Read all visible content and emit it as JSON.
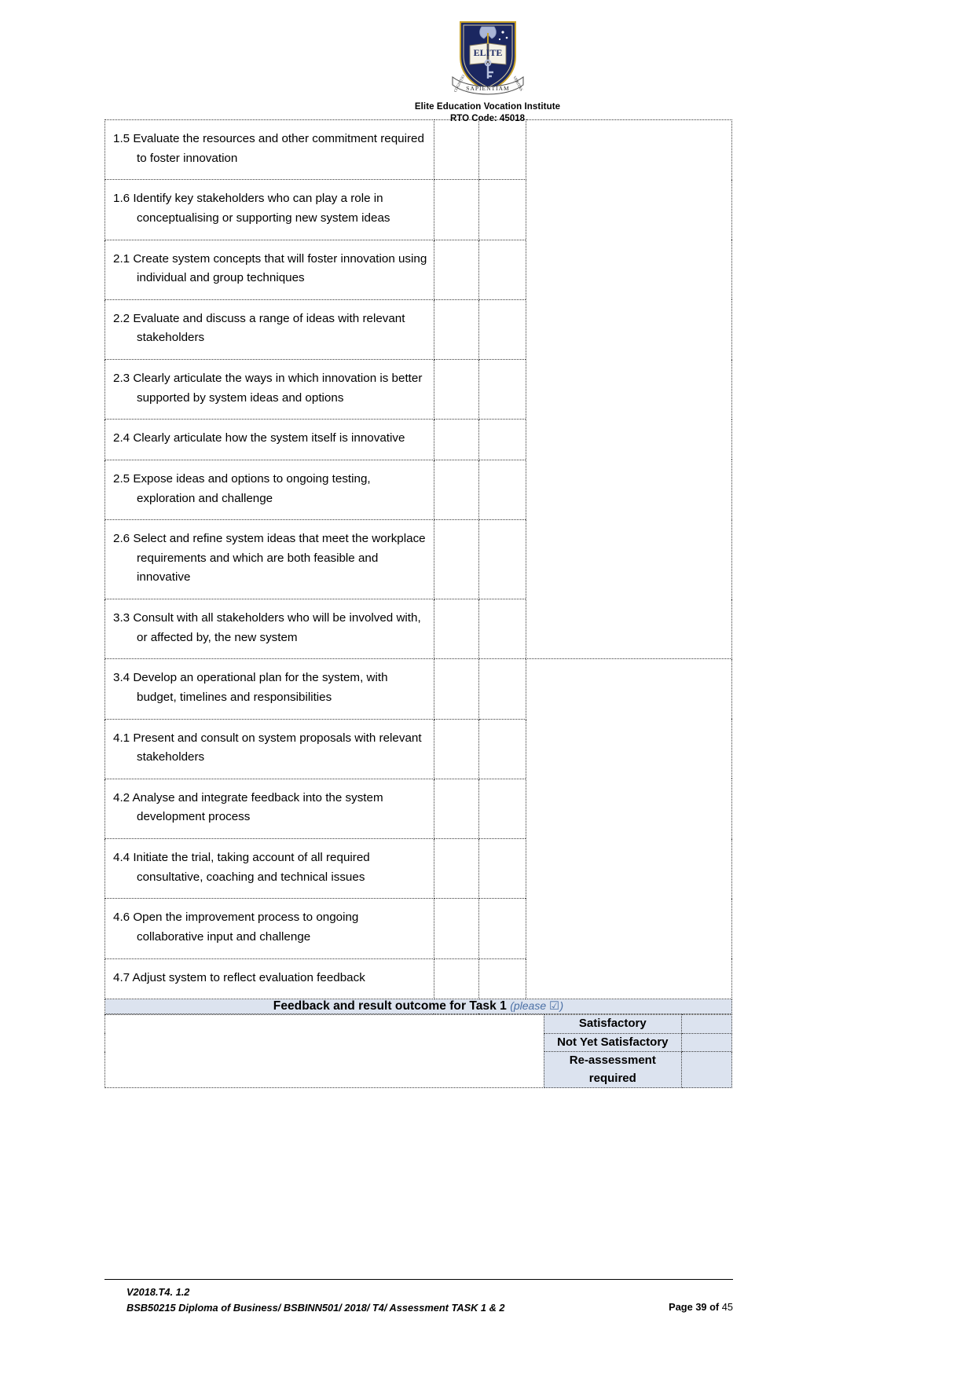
{
  "header": {
    "logo_icon": "elite-shield-crest",
    "crest_motto_left": "COGNITIO",
    "crest_motto_right": "VERITAS",
    "crest_motto_bottom": "SAPIENTIAM",
    "crest_word": "ELITE",
    "organisation": "Elite Education Vocation Institute",
    "rto_code": "RTO Code: 45018"
  },
  "criteria_rows": [
    {
      "text": "1.5 Evaluate the resources and other commitment required to foster innovation"
    },
    {
      "text": "1.6 Identify key stakeholders who can play a role in conceptualising or supporting new system ideas"
    },
    {
      "text": "2.1 Create system concepts that will foster innovation using individual and group techniques"
    },
    {
      "text": "2.2 Evaluate and discuss a range of ideas with relevant stakeholders"
    },
    {
      "text": "2.3 Clearly articulate the ways in which innovation is better supported by system ideas and options"
    },
    {
      "text": "2.4 Clearly articulate how the system itself is innovative"
    },
    {
      "text": "2.5 Expose ideas and options to ongoing testing, exploration and challenge"
    },
    {
      "text": "2.6 Select and refine system ideas that meet the workplace requirements and which are both feasible and innovative"
    },
    {
      "text": "3.3 Consult with all stakeholders who will be involved with, or affected by, the new system"
    },
    {
      "text": "3.4 Develop an operational plan for the system, with budget, timelines and responsibilities"
    },
    {
      "text": "4.1 Present and consult on system proposals with relevant stakeholders"
    },
    {
      "text": "4.2 Analyse and integrate feedback into the system development process"
    },
    {
      "text": "4.4 Initiate the trial, taking account of all required consultative, coaching and technical issues"
    },
    {
      "text": "4.6 Open the improvement process to ongoing collaborative input and challenge"
    },
    {
      "text": "4.7 Adjust system to reflect evaluation feedback"
    }
  ],
  "feedback": {
    "title": "Feedback and result outcome for Task 1",
    "note_open": "(please",
    "tick_icon": "checked-box-glyph",
    "tick_symbol": "☑",
    "note_close": ")",
    "band_color": "#dce3ef",
    "note_color": "#4a6fa5"
  },
  "outcomes": [
    {
      "label": "Satisfactory"
    },
    {
      "label": "Not Yet Satisfactory"
    },
    {
      "label": "Re-assessment required"
    }
  ],
  "footer": {
    "version": "V2018.T4. 1.2",
    "course_line": "BSB50215 Diploma of Business/ BSBINN501/ 2018/ T4/ Assessment TASK 1 & 2",
    "page_word": "Page",
    "page_number": "39",
    "of_word": "of",
    "page_total": "45"
  }
}
